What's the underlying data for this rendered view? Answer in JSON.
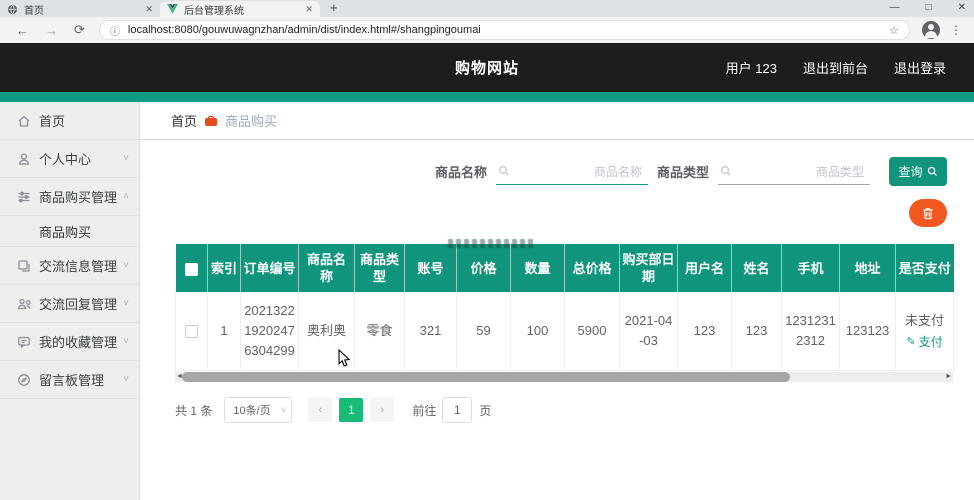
{
  "icons": {
    "minimize": "—",
    "maximize": "□",
    "close": "✕",
    "tab_close": "✕",
    "new_tab": "+",
    "back": "←",
    "forward": "→",
    "refresh": "⟳",
    "info": "ⓘ",
    "star": "☆",
    "menu": "⋮",
    "chevron_down": "˅",
    "chevron_up": "˄",
    "pen": "✎",
    "scroll_left": "◄",
    "scroll_right": "►"
  },
  "browser": {
    "tabs": [
      {
        "title": "首页"
      },
      {
        "title": "后台管理系统"
      }
    ],
    "url": "localhost:8080/gouwuwagnzhan/admin/dist/index.html#/shangpingoumai"
  },
  "header": {
    "title": "购物网站",
    "user": "用户 123",
    "exit_front": "退出到前台",
    "logout": "退出登录"
  },
  "sidebar": {
    "items": [
      {
        "label": "首页",
        "icon": "home-icon"
      },
      {
        "label": "个人中心",
        "icon": "user-icon"
      },
      {
        "label": "商品购买管理",
        "icon": "operation-icon"
      },
      {
        "label": "交流信息管理",
        "icon": "documents-icon"
      },
      {
        "label": "交流回复管理",
        "icon": "people-icon"
      },
      {
        "label": "我的收藏管理",
        "icon": "chat-icon"
      },
      {
        "label": "留言板管理",
        "icon": "compass-icon"
      }
    ],
    "submenu": {
      "label": "商品购买"
    }
  },
  "breadcrumb": {
    "home": "首页",
    "current": "商品购买"
  },
  "search": {
    "name_label": "商品名称",
    "name_placeholder": "商品名称",
    "type_label": "商品类型",
    "type_placeholder": "商品类型",
    "query_button": "查询"
  },
  "table": {
    "headers": [
      "索引",
      "订单编号",
      "商品名称",
      "商品类型",
      "账号",
      "价格",
      "数量",
      "总价格",
      "购买部日期",
      "用户名",
      "姓名",
      "手机",
      "地址",
      "是否支付"
    ],
    "row": {
      "index": "1",
      "order_no": "202132219202476304299",
      "product_name": "奥利奥",
      "product_type": "零食",
      "account": "321",
      "price": "59",
      "quantity": "100",
      "total_price": "5900",
      "buy_date": "2021-04-03",
      "username": "123",
      "name": "123",
      "phone": "12312312312",
      "address": "123123",
      "pay_status": "未支付",
      "pay_action": "支付"
    }
  },
  "pagination": {
    "total": "共 1 条",
    "page_size": "10条/页",
    "current_page": "1",
    "goto_label": "前往",
    "goto_value": "1",
    "goto_unit": "页"
  },
  "colors": {
    "accent_teal": "#0F9A83",
    "table_header_teal": "#10947C",
    "active_page_green": "#18BC77",
    "delete_orange": "#F2581F",
    "header_dark": "#1D1D1D"
  }
}
